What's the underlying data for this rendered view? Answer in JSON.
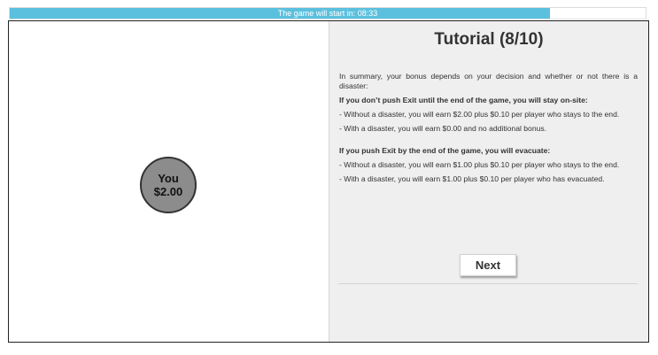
{
  "progress": {
    "label": "The game will start in: 08:33",
    "fraction": 0.85,
    "fill_color": "#5bc0de"
  },
  "player": {
    "name": "You",
    "amount": "$2.00",
    "node_color": "#8c8c8c"
  },
  "tutorial": {
    "title": "Tutorial (8/10)",
    "summary": "In summary, your bonus depends on your decision and whether or not there is a disaster:",
    "stay_heading": "If you don’t push Exit until the end of the game, you will stay on-site:",
    "stay_no_disaster": "- Without a disaster, you will earn $2.00 plus $0.10 per player who stays to the end.",
    "stay_disaster": "- With a disaster, you will earn $0.00 and no additional bonus.",
    "exit_heading": "If you push Exit by the end of the game, you will evacuate:",
    "exit_no_disaster": "- Without a disaster, you will earn $1.00 plus $0.10 per player who stays to the end.",
    "exit_disaster": "- With a disaster, you will earn $1.00 plus $0.10 per player who has evacuated.",
    "next_label": "Next"
  }
}
